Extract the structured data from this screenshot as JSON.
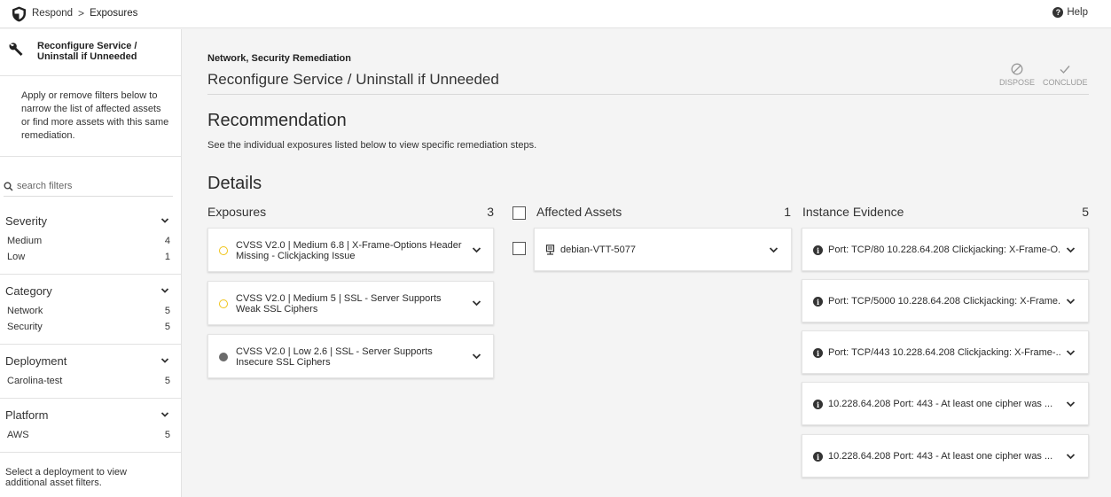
{
  "topbar": {
    "breadcrumb_root": "Respond",
    "breadcrumb_sep": ">",
    "breadcrumb_current": "Exposures",
    "help_label": "Help"
  },
  "sidebar": {
    "title": "Reconfigure Service / Uninstall if Unneeded",
    "info": "Apply or remove filters below to narrow the list of affected assets or find more assets with this same remediation.",
    "search_placeholder": "search filters",
    "groups": [
      {
        "label": "Severity",
        "items": [
          {
            "label": "Medium",
            "count": "4"
          },
          {
            "label": "Low",
            "count": "1"
          }
        ]
      },
      {
        "label": "Category",
        "items": [
          {
            "label": "Network",
            "count": "5"
          },
          {
            "label": "Security",
            "count": "5"
          }
        ]
      },
      {
        "label": "Deployment",
        "items": [
          {
            "label": "Carolina-test",
            "count": "5"
          }
        ]
      },
      {
        "label": "Platform",
        "items": [
          {
            "label": "AWS",
            "count": "5"
          }
        ]
      }
    ],
    "footer": "Select a deployment to view additional asset filters."
  },
  "main": {
    "subtitle": "Network, Security Remediation",
    "title": "Reconfigure Service / Uninstall if Unneeded",
    "actions": {
      "dispose": "DISPOSE",
      "conclude": "CONCLUDE"
    },
    "recommendation_heading": "Recommendation",
    "recommendation_text": "See the individual exposures listed below to view specific remediation steps.",
    "details_heading": "Details",
    "exposures": {
      "label": "Exposures",
      "count": "3",
      "items": [
        {
          "text": "CVSS V2.0 | Medium 6.8 | X-Frame-Options Header Missing - Clickjacking Issue",
          "severity": "medium"
        },
        {
          "text": "CVSS V2.0 | Medium 5 | SSL - Server Supports Weak SSL Ciphers",
          "severity": "medium"
        },
        {
          "text": "CVSS V2.0 | Low 2.6 | SSL - Server Supports Insecure SSL Ciphers",
          "severity": "low"
        }
      ]
    },
    "assets": {
      "label": "Affected Assets",
      "count": "1",
      "items": [
        {
          "name": "debian-VTT-5077"
        }
      ]
    },
    "evidence": {
      "label": "Instance Evidence",
      "count": "5",
      "items": [
        {
          "text": "Port: TCP/80 10.228.64.208 Clickjacking: X-Frame-O..."
        },
        {
          "text": "Port: TCP/5000 10.228.64.208 Clickjacking: X-Frame..."
        },
        {
          "text": "Port: TCP/443 10.228.64.208 Clickjacking: X-Frame-..."
        },
        {
          "text": "10.228.64.208 Port: 443 - At least one cipher was ..."
        },
        {
          "text": "10.228.64.208 Port: 443 - At least one cipher was ..."
        }
      ]
    }
  },
  "colors": {
    "medium": "#f0c419",
    "low": "#6b6b6b"
  }
}
